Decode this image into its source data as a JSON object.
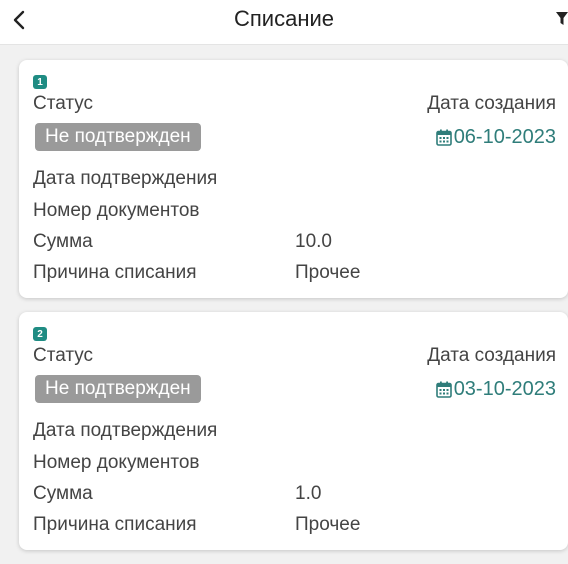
{
  "header": {
    "title": "Списание",
    "back_icon": "chevron-left-icon",
    "filter_icon": "filter-icon"
  },
  "colors": {
    "accent": "#1f8c83",
    "date_text": "#2f7d7a",
    "status_pill": "#9a9a9a"
  },
  "cards": [
    {
      "index": "1",
      "status_label": "Статус",
      "status_value": "Не подтвержден",
      "created_label": "Дата создания",
      "created_date": "06-10-2023",
      "confirm_label": "Дата подтверждения",
      "confirm_value": "",
      "docs_label": "Номер документов",
      "docs_value": "",
      "sum_label": "Сумма",
      "sum_value": "10.0",
      "reason_label": "Причина списания",
      "reason_value": "Прочее"
    },
    {
      "index": "2",
      "status_label": "Статус",
      "status_value": "Не подтвержден",
      "created_label": "Дата создания",
      "created_date": "03-10-2023",
      "confirm_label": "Дата подтверждения",
      "confirm_value": "",
      "docs_label": "Номер документов",
      "docs_value": "",
      "sum_label": "Сумма",
      "sum_value": "1.0",
      "reason_label": "Причина списания",
      "reason_value": "Прочее"
    }
  ]
}
